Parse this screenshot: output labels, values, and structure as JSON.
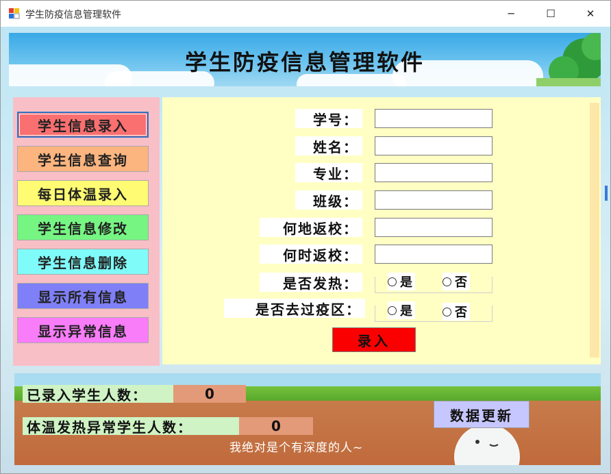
{
  "window": {
    "title": "学生防疫信息管理软件",
    "controls": {
      "minimize": "─",
      "maximize": "☐",
      "close": "✕"
    }
  },
  "banner": {
    "title": "学生防疫信息管理软件"
  },
  "nav": {
    "items": [
      {
        "label": "学生信息录入",
        "color": "#fa6f70"
      },
      {
        "label": "学生信息查询",
        "color": "#fcb57f"
      },
      {
        "label": "每日体温录入",
        "color": "#fffb72"
      },
      {
        "label": "学生信息修改",
        "color": "#76f583"
      },
      {
        "label": "学生信息删除",
        "color": "#7ffcfa"
      },
      {
        "label": "显示所有信息",
        "color": "#7f7ff8"
      },
      {
        "label": "显示异常信息",
        "color": "#f97cf9"
      }
    ]
  },
  "form": {
    "fields": [
      {
        "label": "学号：",
        "value": ""
      },
      {
        "label": "姓名：",
        "value": ""
      },
      {
        "label": "专业：",
        "value": ""
      },
      {
        "label": "班级：",
        "value": ""
      },
      {
        "label": "何地返校：",
        "value": ""
      },
      {
        "label": "何时返校：",
        "value": ""
      }
    ],
    "fever": {
      "label": "是否发热：",
      "yes": "是",
      "no": "否"
    },
    "risk_area": {
      "label": "是否去过疫区：",
      "yes": "是",
      "no": "否"
    },
    "submit_label": "录入"
  },
  "stats": {
    "entered_label": "已录入学生人数：",
    "entered_value": "0",
    "fever_label": "体温发热异常学生人数：",
    "fever_value": "0",
    "refresh_label": "数据更新",
    "caption": "我绝对是个有深度的人~"
  }
}
